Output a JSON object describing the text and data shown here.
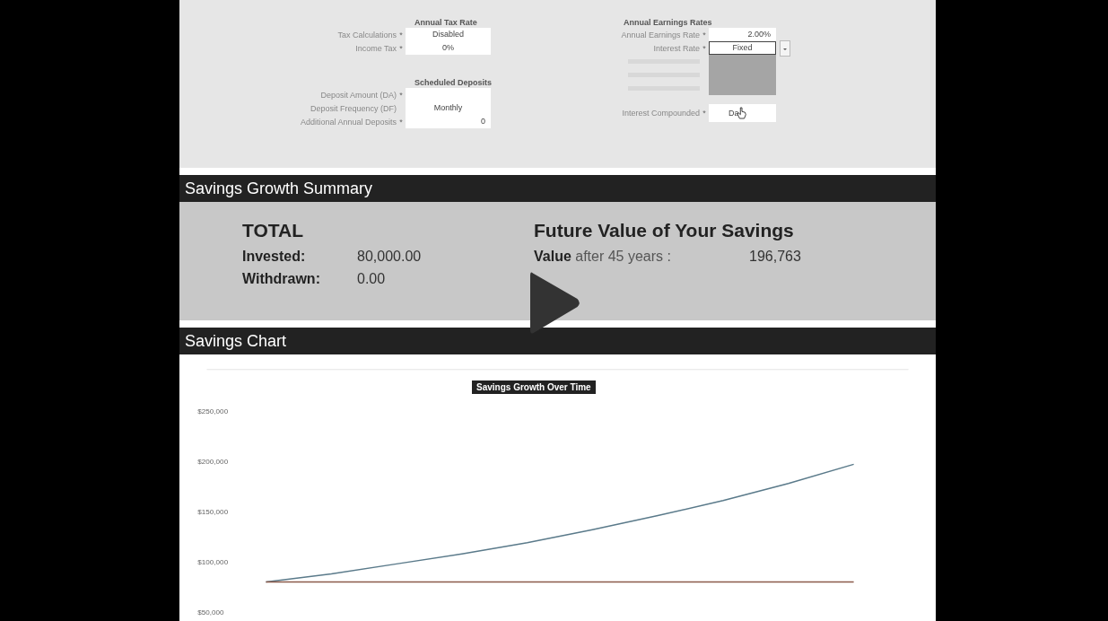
{
  "tax": {
    "heading": "Annual Tax Rate",
    "fields": [
      {
        "label": "Tax Calculations",
        "mark": "*",
        "value": "Disabled"
      },
      {
        "label": "Income Tax",
        "mark": "*",
        "value": "0%"
      }
    ]
  },
  "deposits": {
    "heading": "Scheduled Deposits",
    "fields": [
      {
        "label": "Deposit Amount (DA)",
        "mark": "*"
      },
      {
        "label": "Deposit Frequency (DF)",
        "value": "Monthly"
      },
      {
        "label": "Additional Annual Deposits",
        "mark": "*",
        "value": "0"
      }
    ]
  },
  "earnings": {
    "heading": "Annual Earnings Rates",
    "fields": [
      {
        "label": "Annual Earnings Rate",
        "mark": "*",
        "value": "2.00%",
        "kind": "text"
      },
      {
        "label": "Interest Rate",
        "mark": "*",
        "value": "Fixed",
        "kind": "dropdown"
      }
    ]
  },
  "compounded": {
    "label": "Interest Compounded",
    "mark": "*",
    "value": "Da"
  },
  "summary": {
    "title": "Savings Growth Summary",
    "total_heading": "TOTAL",
    "rows": [
      {
        "label": "Invested:",
        "value": "80,000.00"
      },
      {
        "label": "Withdrawn:",
        "value": "0.00"
      }
    ],
    "future_heading": "Future Value of Your Savings",
    "value_label": "**Value** after 45 years :",
    "value": "196,763"
  },
  "chart_section": {
    "title": "Savings Chart",
    "chart_data": {
      "type": "line",
      "title": "Savings Growth Over Time",
      "ylim": [
        50000,
        250000
      ],
      "yticks": [
        {
          "value": 250000,
          "label": "$250,000"
        },
        {
          "value": 200000,
          "label": "$200,000"
        },
        {
          "value": 150000,
          "label": "$150,000"
        },
        {
          "value": 100000,
          "label": "$100,000"
        },
        {
          "value": 50000,
          "label": "$50,000"
        }
      ],
      "series": [
        {
          "color": "#5a7a8a",
          "values": [
            80000,
            88000,
            98000,
            108000,
            119000,
            132000,
            146000,
            161000,
            178000,
            197000
          ]
        },
        {
          "color": "#8a5a4a",
          "values": [
            80000,
            80000,
            80000,
            80000,
            80000,
            80000,
            80000,
            80000,
            80000,
            80000
          ]
        }
      ]
    }
  }
}
